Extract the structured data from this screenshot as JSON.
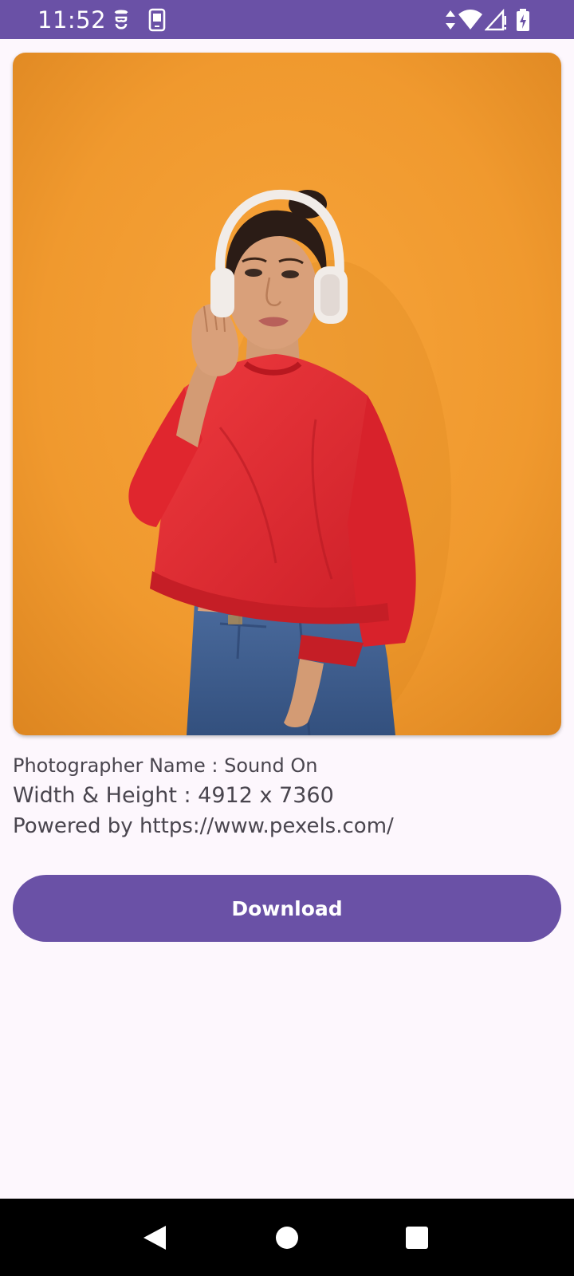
{
  "status_bar": {
    "time": "11:52",
    "background_color": "#6a51a6",
    "icons": [
      "data-saver-icon",
      "sim-card-icon",
      "data-arrows-icon",
      "wifi-icon",
      "cellular-signal-icon",
      "battery-charging-icon"
    ]
  },
  "photo": {
    "background_color": "#f29a2e",
    "subject_colors": {
      "sweater": "#e42b32",
      "jeans": "#3e5c8c",
      "headphones": "#f1ece8"
    }
  },
  "details": {
    "photographer": "Photographer Name : Sound On",
    "dimensions": "Width & Height : 4912 x 7360",
    "powered_by": "Powered by https://www.pexels.com/"
  },
  "download_button": {
    "label": "Download",
    "color": "#6a51a6"
  },
  "nav_bar": {
    "buttons": [
      "back-icon",
      "home-icon",
      "recents-icon"
    ]
  }
}
